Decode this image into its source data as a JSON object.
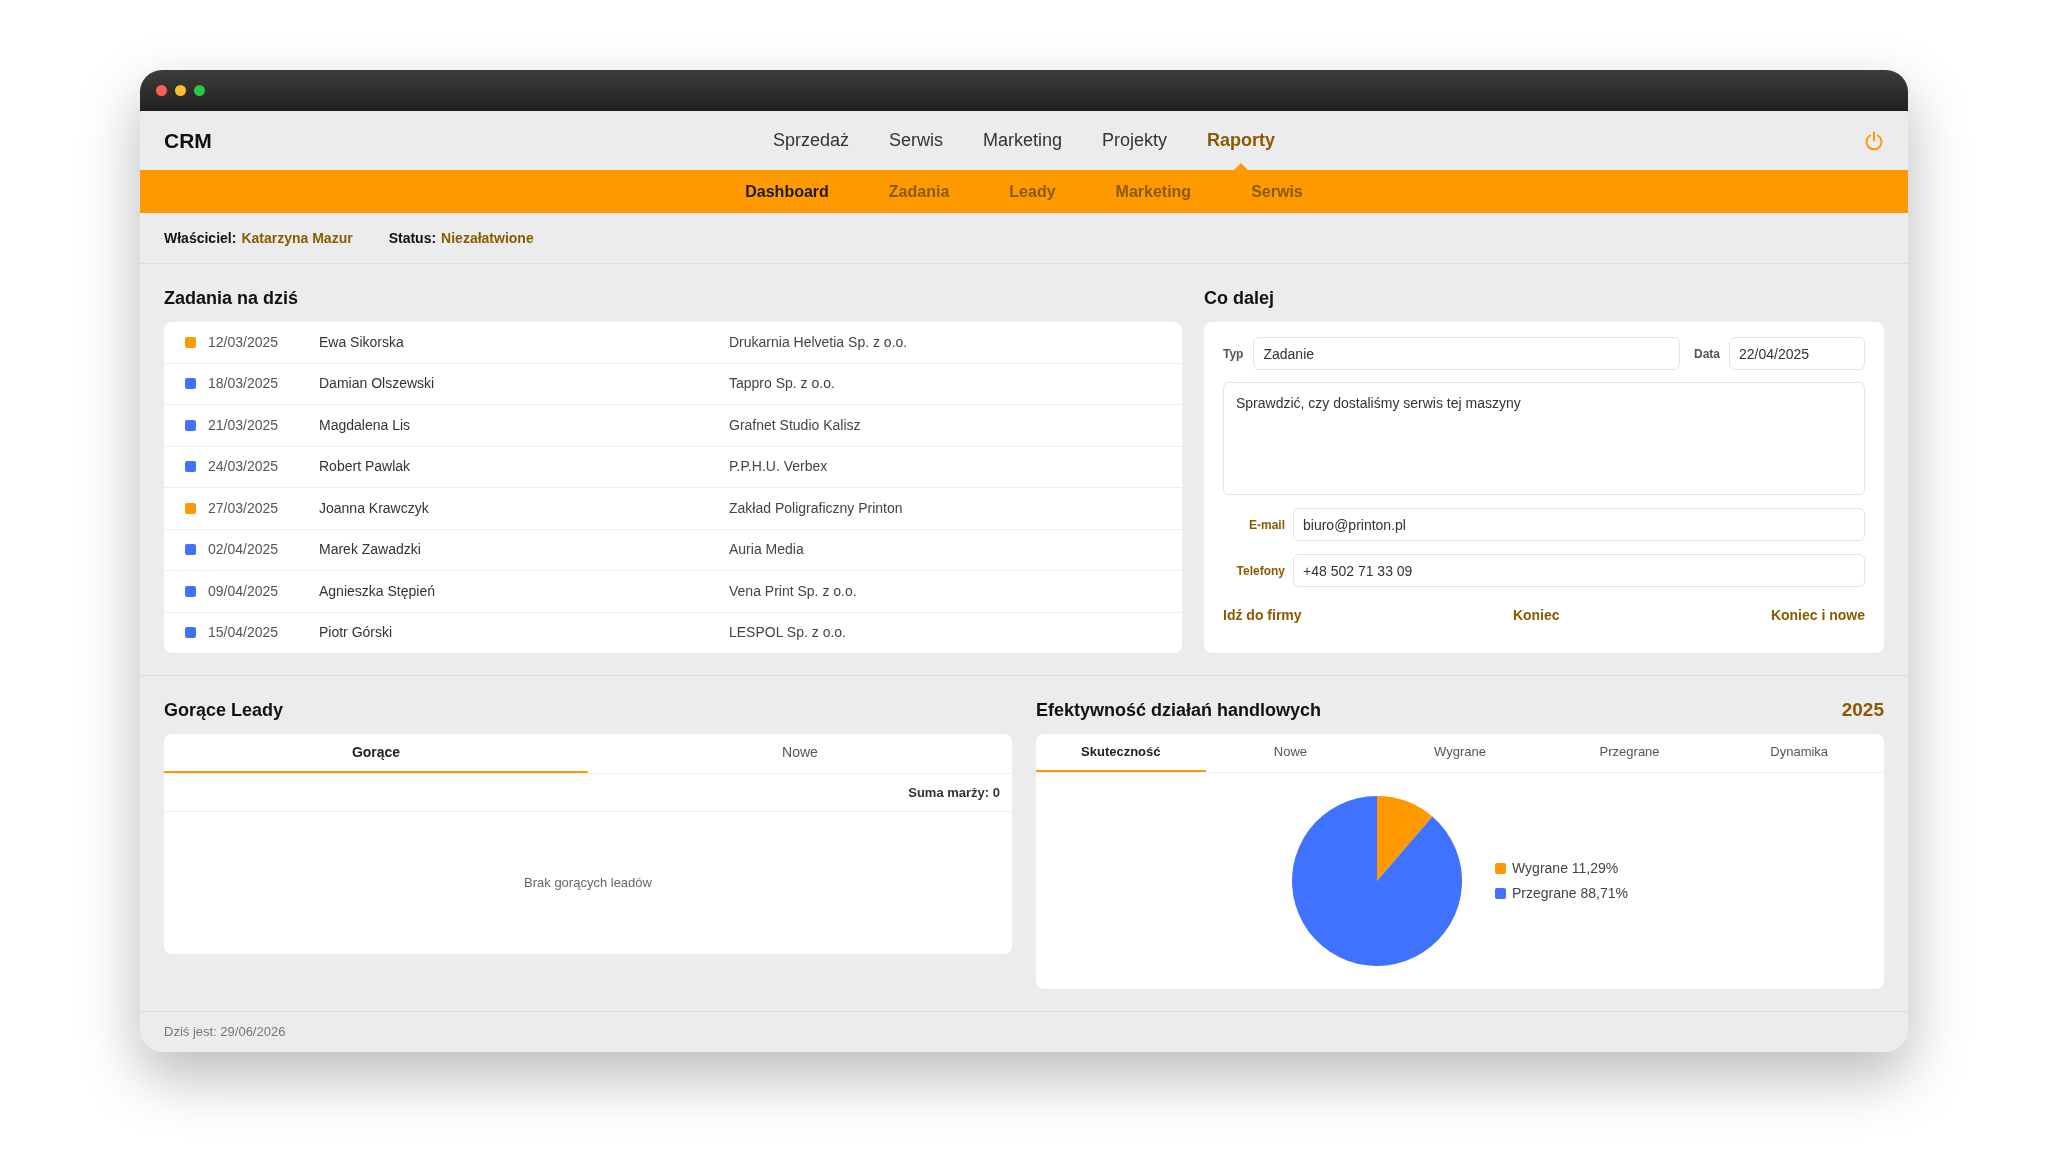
{
  "header": {
    "logo": "CRM",
    "nav": [
      {
        "label": "Sprzedaż",
        "selected": false
      },
      {
        "label": "Serwis",
        "selected": false
      },
      {
        "label": "Marketing",
        "selected": false
      },
      {
        "label": "Projekty",
        "selected": false
      },
      {
        "label": "Raporty",
        "selected": true
      }
    ]
  },
  "subnav": [
    {
      "label": "Dashboard",
      "selected": true
    },
    {
      "label": "Zadania",
      "selected": false
    },
    {
      "label": "Leady",
      "selected": false
    },
    {
      "label": "Marketing",
      "selected": false
    },
    {
      "label": "Serwis",
      "selected": false
    }
  ],
  "info": [
    {
      "label": "Właściciel:",
      "value": "Katarzyna Mazur"
    },
    {
      "label": "Status:",
      "value": "Niezałatwione"
    }
  ],
  "tasks": {
    "title": "Zadania na dziś",
    "rows": [
      {
        "color": "#ff9900",
        "date": "12/03/2025",
        "person": "Ewa Sikorska",
        "company": "Drukarnia Helvetia Sp. z o.o."
      },
      {
        "color": "#3f72ff",
        "date": "18/03/2025",
        "person": "Damian Olszewski",
        "company": "Tappro Sp. z o.o."
      },
      {
        "color": "#3f72ff",
        "date": "21/03/2025",
        "person": "Magdalena Lis",
        "company": "Grafnet Studio Kalisz"
      },
      {
        "color": "#3f72ff",
        "date": "24/03/2025",
        "person": "Robert Pawlak",
        "company": "P.P.H.U. Verbex"
      },
      {
        "color": "#ff9900",
        "date": "27/03/2025",
        "person": "Joanna Krawczyk",
        "company": "Zakład Poligraficzny Printon"
      },
      {
        "color": "#3f72ff",
        "date": "02/04/2025",
        "person": "Marek Zawadzki",
        "company": "Auria Media"
      },
      {
        "color": "#3f72ff",
        "date": "09/04/2025",
        "person": "Agnieszka Stępień",
        "company": "Vena Print Sp. z o.o."
      },
      {
        "color": "#3f72ff",
        "date": "15/04/2025",
        "person": "Piotr Górski",
        "company": "LESPOL Sp. z o.o."
      }
    ]
  },
  "next_step": {
    "title": "Co dalej",
    "type": {
      "label": "Typ",
      "value": "Zadanie"
    },
    "date": {
      "label": "Data",
      "value": "22/04/2025"
    },
    "note": "Sprawdzić, czy dostaliśmy serwis tej maszyny",
    "email": {
      "label": "E-mail",
      "value": "biuro@printon.pl"
    },
    "phone": {
      "label": "Telefony",
      "value": "+48 502 71 33 09"
    },
    "actions": [
      "Idź do firmy",
      "Koniec",
      "Koniec i nowe"
    ]
  },
  "hot_leads": {
    "title": "Gorące Leady",
    "tabs": [
      {
        "label": "Gorące",
        "selected": true
      },
      {
        "label": "Nowe",
        "selected": false
      }
    ],
    "margin_sum": "Suma marży: 0",
    "empty_message": "Brak gorących leadów"
  },
  "efficiency": {
    "title": "Efektywność działań handlowych",
    "year": "2025",
    "tabs": [
      {
        "label": "Skuteczność",
        "selected": true
      },
      {
        "label": "Nowe",
        "selected": false
      },
      {
        "label": "Wygrane",
        "selected": false
      },
      {
        "label": "Przegrane",
        "selected": false
      },
      {
        "label": "Dynamika",
        "selected": false
      }
    ],
    "chart_data": {
      "type": "pie",
      "categories": [
        "Wygrane",
        "Przegrane"
      ],
      "values": [
        11.29,
        88.71
      ]
    },
    "legend": [
      {
        "share": "11,29%",
        "color": "#ff9900"
      },
      {
        "share": "88,71%",
        "color": "#3f72ff"
      }
    ]
  },
  "status_bar": {
    "today": "Dziś jest: 29/06/2026"
  }
}
